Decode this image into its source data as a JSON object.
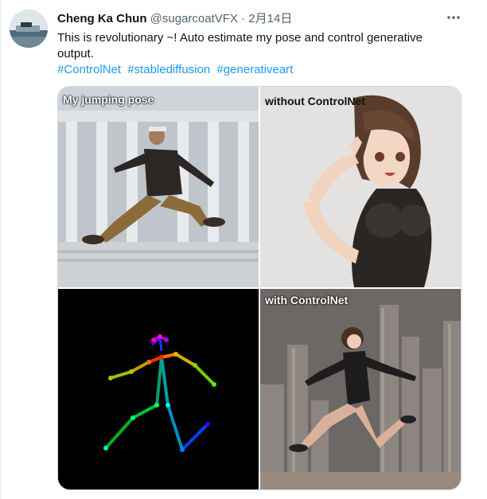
{
  "tweet": {
    "author_name": "Cheng Ka Chun",
    "author_handle": "@sugarcoatVFX",
    "separator": "·",
    "date": "2月14日",
    "more_icon": "more-horizontal-icon",
    "text": "This is revolutionary ~! Auto estimate my pose and control generative output.",
    "hashtags": [
      "#ControlNet",
      "#stablediffusion",
      "#generativeart"
    ]
  },
  "media": {
    "panels": [
      {
        "label": "My jumping pose"
      },
      {
        "label": "without ControlNet"
      },
      {
        "label": ""
      },
      {
        "label": "with ControlNet"
      }
    ]
  },
  "colors": {
    "link": "#1d9bf0",
    "secondary_text": "#536471",
    "border": "#cfd9de"
  }
}
